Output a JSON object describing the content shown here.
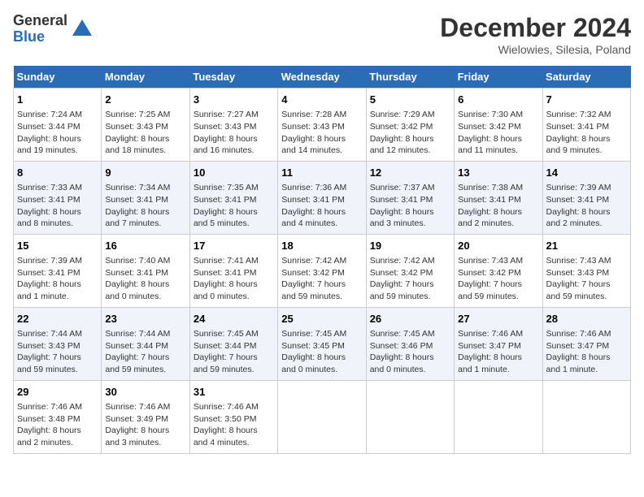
{
  "header": {
    "logo_general": "General",
    "logo_blue": "Blue",
    "title": "December 2024",
    "location": "Wielowies, Silesia, Poland"
  },
  "days_of_week": [
    "Sunday",
    "Monday",
    "Tuesday",
    "Wednesday",
    "Thursday",
    "Friday",
    "Saturday"
  ],
  "weeks": [
    [
      {
        "day": "1",
        "info": "Sunrise: 7:24 AM\nSunset: 3:44 PM\nDaylight: 8 hours\nand 19 minutes."
      },
      {
        "day": "2",
        "info": "Sunrise: 7:25 AM\nSunset: 3:43 PM\nDaylight: 8 hours\nand 18 minutes."
      },
      {
        "day": "3",
        "info": "Sunrise: 7:27 AM\nSunset: 3:43 PM\nDaylight: 8 hours\nand 16 minutes."
      },
      {
        "day": "4",
        "info": "Sunrise: 7:28 AM\nSunset: 3:43 PM\nDaylight: 8 hours\nand 14 minutes."
      },
      {
        "day": "5",
        "info": "Sunrise: 7:29 AM\nSunset: 3:42 PM\nDaylight: 8 hours\nand 12 minutes."
      },
      {
        "day": "6",
        "info": "Sunrise: 7:30 AM\nSunset: 3:42 PM\nDaylight: 8 hours\nand 11 minutes."
      },
      {
        "day": "7",
        "info": "Sunrise: 7:32 AM\nSunset: 3:41 PM\nDaylight: 8 hours\nand 9 minutes."
      }
    ],
    [
      {
        "day": "8",
        "info": "Sunrise: 7:33 AM\nSunset: 3:41 PM\nDaylight: 8 hours\nand 8 minutes."
      },
      {
        "day": "9",
        "info": "Sunrise: 7:34 AM\nSunset: 3:41 PM\nDaylight: 8 hours\nand 7 minutes."
      },
      {
        "day": "10",
        "info": "Sunrise: 7:35 AM\nSunset: 3:41 PM\nDaylight: 8 hours\nand 5 minutes."
      },
      {
        "day": "11",
        "info": "Sunrise: 7:36 AM\nSunset: 3:41 PM\nDaylight: 8 hours\nand 4 minutes."
      },
      {
        "day": "12",
        "info": "Sunrise: 7:37 AM\nSunset: 3:41 PM\nDaylight: 8 hours\nand 3 minutes."
      },
      {
        "day": "13",
        "info": "Sunrise: 7:38 AM\nSunset: 3:41 PM\nDaylight: 8 hours\nand 2 minutes."
      },
      {
        "day": "14",
        "info": "Sunrise: 7:39 AM\nSunset: 3:41 PM\nDaylight: 8 hours\nand 2 minutes."
      }
    ],
    [
      {
        "day": "15",
        "info": "Sunrise: 7:39 AM\nSunset: 3:41 PM\nDaylight: 8 hours\nand 1 minute."
      },
      {
        "day": "16",
        "info": "Sunrise: 7:40 AM\nSunset: 3:41 PM\nDaylight: 8 hours\nand 0 minutes."
      },
      {
        "day": "17",
        "info": "Sunrise: 7:41 AM\nSunset: 3:41 PM\nDaylight: 8 hours\nand 0 minutes."
      },
      {
        "day": "18",
        "info": "Sunrise: 7:42 AM\nSunset: 3:42 PM\nDaylight: 7 hours\nand 59 minutes."
      },
      {
        "day": "19",
        "info": "Sunrise: 7:42 AM\nSunset: 3:42 PM\nDaylight: 7 hours\nand 59 minutes."
      },
      {
        "day": "20",
        "info": "Sunrise: 7:43 AM\nSunset: 3:42 PM\nDaylight: 7 hours\nand 59 minutes."
      },
      {
        "day": "21",
        "info": "Sunrise: 7:43 AM\nSunset: 3:43 PM\nDaylight: 7 hours\nand 59 minutes."
      }
    ],
    [
      {
        "day": "22",
        "info": "Sunrise: 7:44 AM\nSunset: 3:43 PM\nDaylight: 7 hours\nand 59 minutes."
      },
      {
        "day": "23",
        "info": "Sunrise: 7:44 AM\nSunset: 3:44 PM\nDaylight: 7 hours\nand 59 minutes."
      },
      {
        "day": "24",
        "info": "Sunrise: 7:45 AM\nSunset: 3:44 PM\nDaylight: 7 hours\nand 59 minutes."
      },
      {
        "day": "25",
        "info": "Sunrise: 7:45 AM\nSunset: 3:45 PM\nDaylight: 8 hours\nand 0 minutes."
      },
      {
        "day": "26",
        "info": "Sunrise: 7:45 AM\nSunset: 3:46 PM\nDaylight: 8 hours\nand 0 minutes."
      },
      {
        "day": "27",
        "info": "Sunrise: 7:46 AM\nSunset: 3:47 PM\nDaylight: 8 hours\nand 1 minute."
      },
      {
        "day": "28",
        "info": "Sunrise: 7:46 AM\nSunset: 3:47 PM\nDaylight: 8 hours\nand 1 minute."
      }
    ],
    [
      {
        "day": "29",
        "info": "Sunrise: 7:46 AM\nSunset: 3:48 PM\nDaylight: 8 hours\nand 2 minutes."
      },
      {
        "day": "30",
        "info": "Sunrise: 7:46 AM\nSunset: 3:49 PM\nDaylight: 8 hours\nand 3 minutes."
      },
      {
        "day": "31",
        "info": "Sunrise: 7:46 AM\nSunset: 3:50 PM\nDaylight: 8 hours\nand 4 minutes."
      },
      {
        "day": "",
        "info": ""
      },
      {
        "day": "",
        "info": ""
      },
      {
        "day": "",
        "info": ""
      },
      {
        "day": "",
        "info": ""
      }
    ]
  ]
}
